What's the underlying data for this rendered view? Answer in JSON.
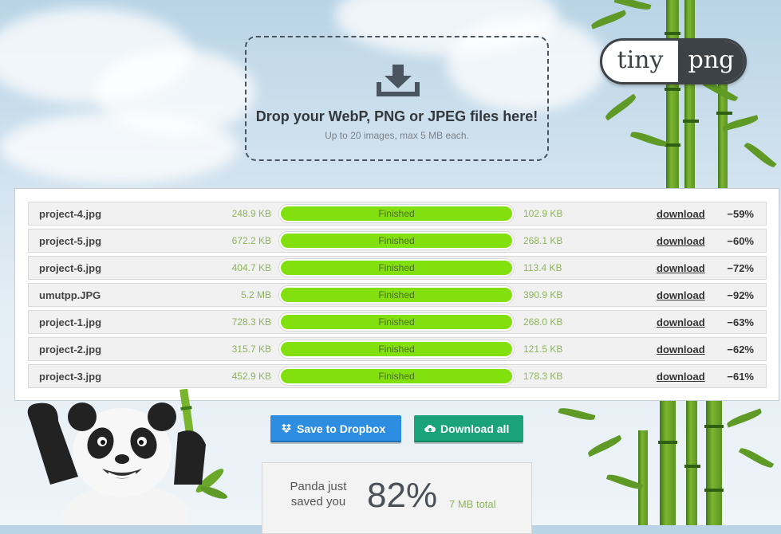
{
  "dropzone": {
    "icon": "tray-download-icon",
    "title": "Drop your WebP, PNG or JPEG files here!",
    "subtitle": "Up to 20 images, max 5 MB each."
  },
  "logo": {
    "left": "tiny",
    "right": "png"
  },
  "files": [
    {
      "name": "project-4.jpg",
      "original": "248.9 KB",
      "status": "Finished",
      "compressed": "102.9 KB",
      "action": "download",
      "saving": "−59%"
    },
    {
      "name": "project-5.jpg",
      "original": "672.2 KB",
      "status": "Finished",
      "compressed": "268.1 KB",
      "action": "download",
      "saving": "−60%"
    },
    {
      "name": "project-6.jpg",
      "original": "404.7 KB",
      "status": "Finished",
      "compressed": "113.4 KB",
      "action": "download",
      "saving": "−72%"
    },
    {
      "name": "umutpp.JPG",
      "original": "5.2 MB",
      "status": "Finished",
      "compressed": "390.9 KB",
      "action": "download",
      "saving": "−92%"
    },
    {
      "name": "project-1.jpg",
      "original": "728.3 KB",
      "status": "Finished",
      "compressed": "268.0 KB",
      "action": "download",
      "saving": "−63%"
    },
    {
      "name": "project-2.jpg",
      "original": "315.7 KB",
      "status": "Finished",
      "compressed": "121.5 KB",
      "action": "download",
      "saving": "−62%"
    },
    {
      "name": "project-3.jpg",
      "original": "452.9 KB",
      "status": "Finished",
      "compressed": "178.3 KB",
      "action": "download",
      "saving": "−61%"
    }
  ],
  "progress": 1.0,
  "buttons": {
    "dropbox": "Save to Dropbox",
    "dropbox_icon": "dropbox-icon",
    "download_all": "Download all",
    "download_all_icon": "cloud-download-icon"
  },
  "savings": {
    "label_line1": "Panda just",
    "label_line2": "saved you",
    "percent": "82%",
    "total": "7 MB total"
  },
  "colors": {
    "progress_fill": "#82e00f",
    "size_text": "#8db45a",
    "dropbox_button": "#2d8de0",
    "download_button": "#1aa37a"
  }
}
